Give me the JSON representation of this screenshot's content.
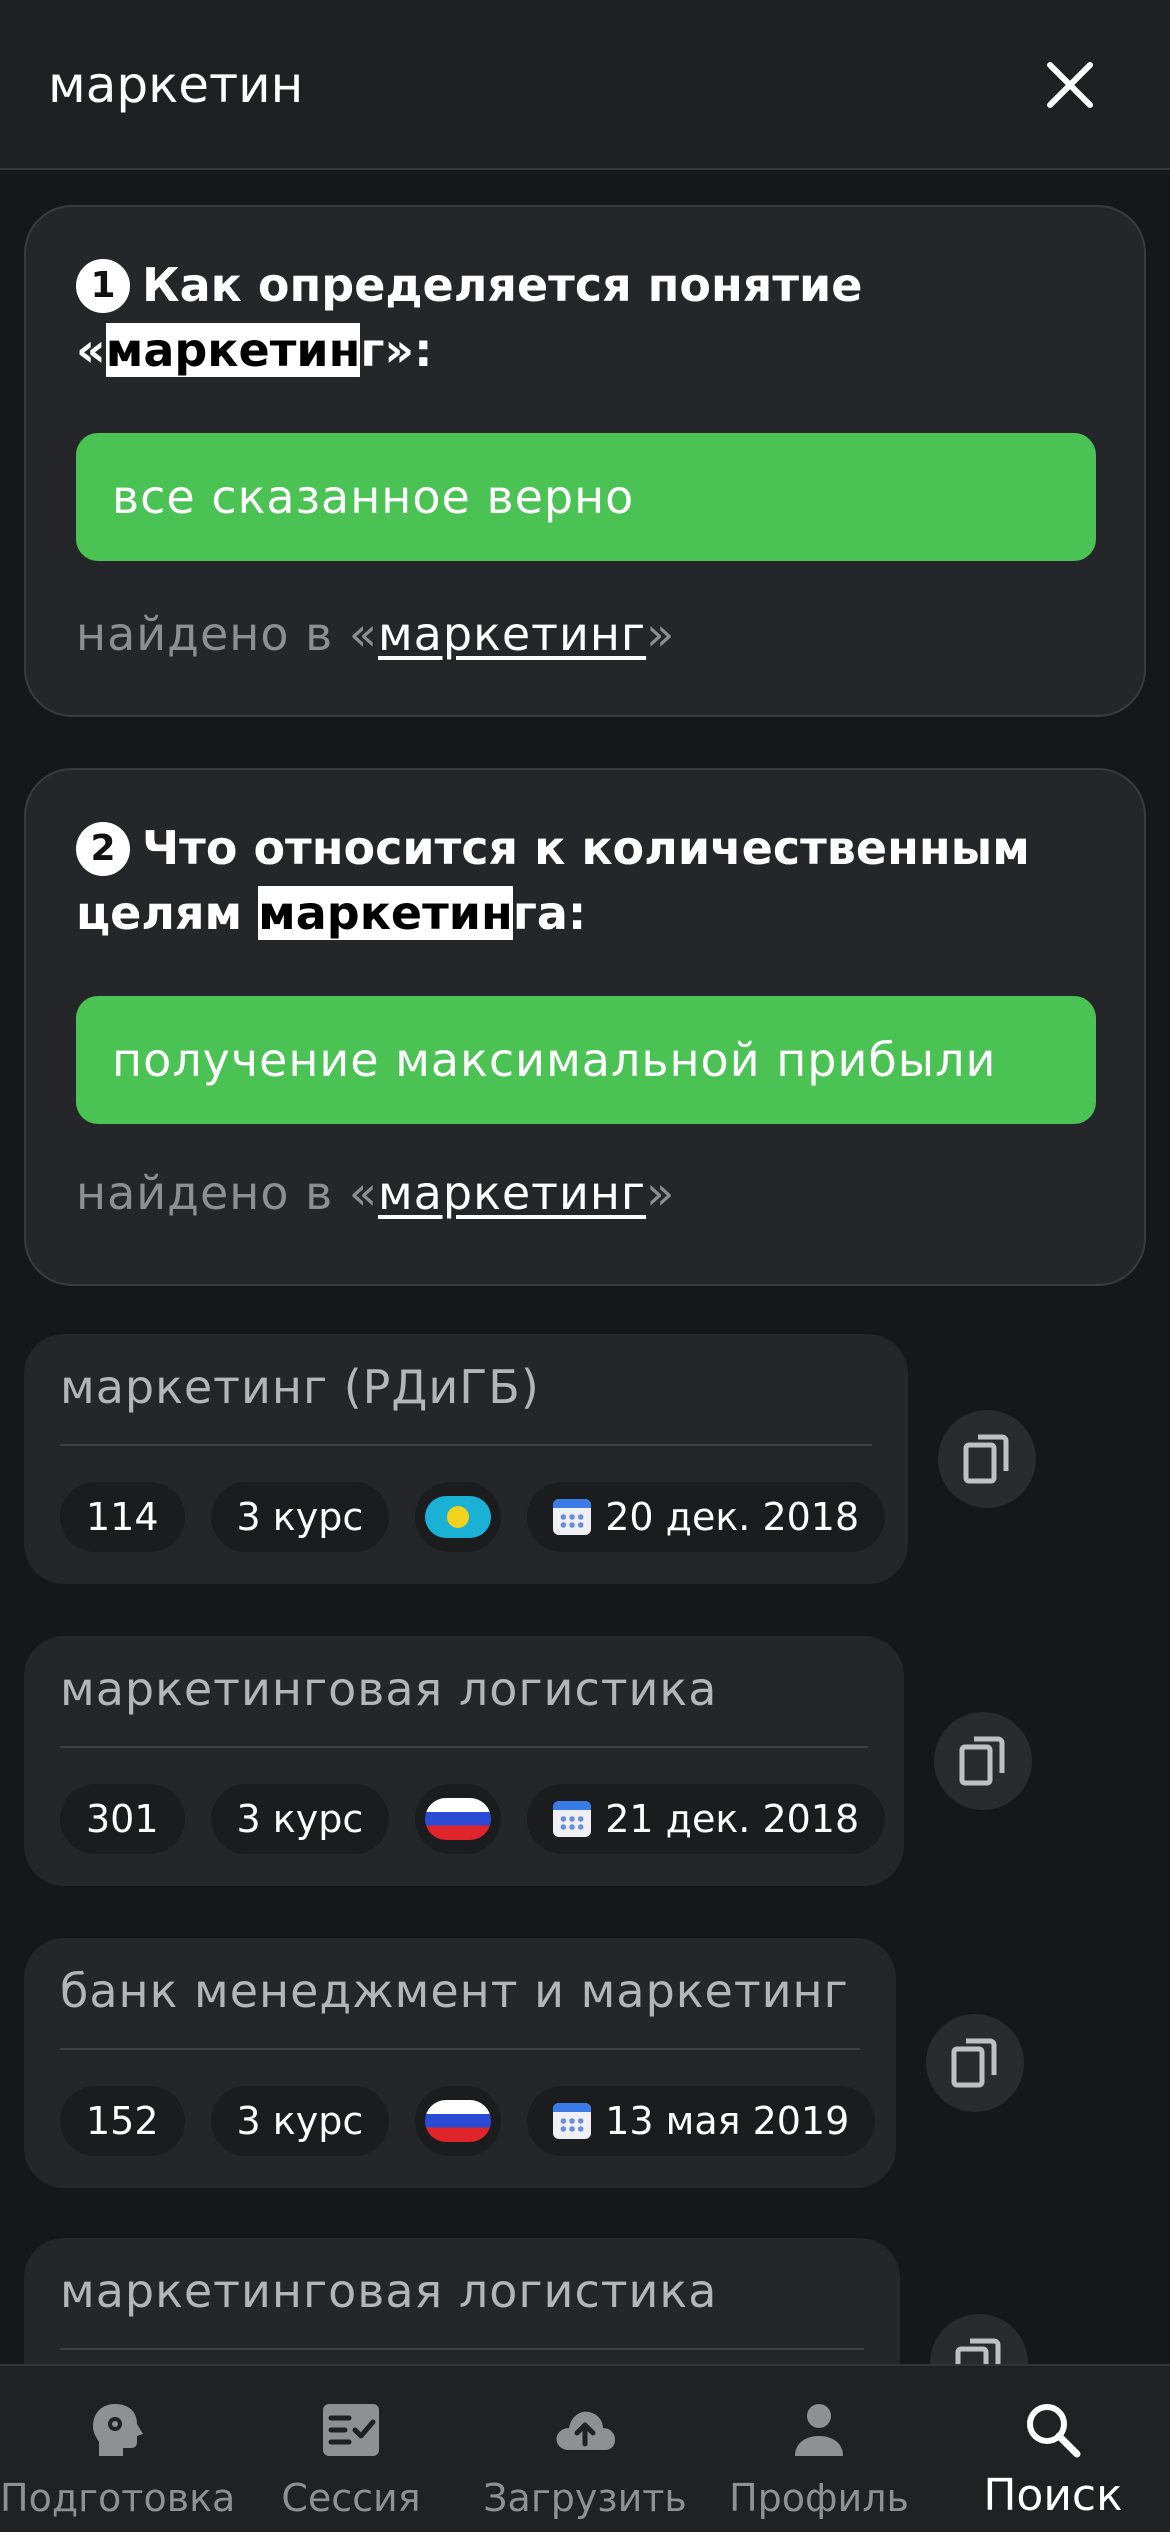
{
  "search": {
    "query": "маркетин"
  },
  "questions": [
    {
      "num": "1",
      "title_pre": "Как определяется понятие «",
      "title_hl": "маркетин",
      "title_post": "г»:",
      "answer": "все сказанное верно",
      "found_prefix": "найдено в «",
      "found_link": "маркетинг",
      "found_suffix": "»"
    },
    {
      "num": "2",
      "title_pre": "Что относится к количественным целям ",
      "title_hl": "маркетин",
      "title_post": "га:",
      "answer": "получение максимальной прибыли",
      "found_prefix": "найдено в «",
      "found_link": "маркетинг",
      "found_suffix": "»"
    }
  ],
  "subjects": [
    {
      "title": "маркетинг (РДиГБ)",
      "count": "114",
      "course": "3 курс",
      "flag": "kazakhstan-flag",
      "date": "20 дек. 2018"
    },
    {
      "title": "маркетинговая логистика",
      "count": "301",
      "course": "3 курс",
      "flag": "russia-flag",
      "date": "21 дек. 2018"
    },
    {
      "title": "банк менеджмент и маркетинг",
      "count": "152",
      "course": "3 курс",
      "flag": "russia-flag",
      "date": "13 мая 2019"
    },
    {
      "title": "маркетинговая логистика"
    }
  ],
  "tabs": [
    {
      "label": "Подготовка",
      "icon": "brain-head-icon"
    },
    {
      "label": "Сессия",
      "icon": "checklist-icon"
    },
    {
      "label": "Загрузить",
      "icon": "cloud-upload-icon"
    },
    {
      "label": "Профиль",
      "icon": "person-icon"
    },
    {
      "label": "Поиск",
      "icon": "search-icon",
      "active": true
    }
  ],
  "colors": {
    "background": "#161719",
    "card": "#252629",
    "answer_green": "#4bc354",
    "muted_text": "#8d8e92"
  }
}
